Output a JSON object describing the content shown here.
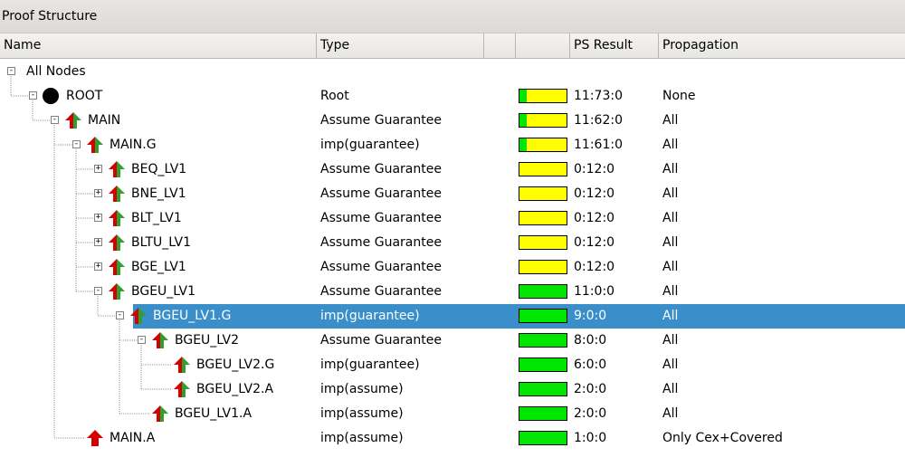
{
  "panel": {
    "title": "Proof Structure"
  },
  "columns": [
    {
      "label": "Name"
    },
    {
      "label": "Type"
    },
    {
      "label": ""
    },
    {
      "label": ""
    },
    {
      "label": "PS Result"
    },
    {
      "label": "Propagation"
    }
  ],
  "colors": {
    "pass": "#00e600",
    "pending": "#ffff00",
    "selection": "#3a8fcb",
    "arrow_red": "#d40000",
    "arrow_green": "#2ea02e"
  },
  "tree": {
    "all_nodes": "All Nodes",
    "rows": [
      {
        "name": "ROOT",
        "type": "Root",
        "result": "11:73:0",
        "propagation": "None",
        "icon": "root-node-icon",
        "pass_fraction": 0.15,
        "expander": "-"
      },
      {
        "name": "MAIN",
        "type": "Assume Guarantee",
        "result": "11:62:0",
        "propagation": "All",
        "icon": "assume-guarantee-icon",
        "pass_fraction": 0.15,
        "expander": "-"
      },
      {
        "name": "MAIN.G",
        "type": "imp(guarantee)",
        "result": "11:61:0",
        "propagation": "All",
        "icon": "assume-guarantee-icon",
        "pass_fraction": 0.15,
        "expander": "-"
      },
      {
        "name": "BEQ_LV1",
        "type": "Assume Guarantee",
        "result": "0:12:0",
        "propagation": "All",
        "icon": "assume-guarantee-icon",
        "pass_fraction": 0,
        "expander": "+"
      },
      {
        "name": "BNE_LV1",
        "type": "Assume Guarantee",
        "result": "0:12:0",
        "propagation": "All",
        "icon": "assume-guarantee-icon",
        "pass_fraction": 0,
        "expander": "+"
      },
      {
        "name": "BLT_LV1",
        "type": "Assume Guarantee",
        "result": "0:12:0",
        "propagation": "All",
        "icon": "assume-guarantee-icon",
        "pass_fraction": 0,
        "expander": "+"
      },
      {
        "name": "BLTU_LV1",
        "type": "Assume Guarantee",
        "result": "0:12:0",
        "propagation": "All",
        "icon": "assume-guarantee-icon",
        "pass_fraction": 0,
        "expander": "+"
      },
      {
        "name": "BGE_LV1",
        "type": "Assume Guarantee",
        "result": "0:12:0",
        "propagation": "All",
        "icon": "assume-guarantee-icon",
        "pass_fraction": 0,
        "expander": "+"
      },
      {
        "name": "BGEU_LV1",
        "type": "Assume Guarantee",
        "result": "11:0:0",
        "propagation": "All",
        "icon": "assume-guarantee-icon",
        "pass_fraction": 1,
        "expander": "-"
      },
      {
        "name": "BGEU_LV1.G",
        "type": "imp(guarantee)",
        "result": "9:0:0",
        "propagation": "All",
        "icon": "assume-guarantee-icon",
        "pass_fraction": 1,
        "expander": "-",
        "selected": true
      },
      {
        "name": "BGEU_LV2",
        "type": "Assume Guarantee",
        "result": "8:0:0",
        "propagation": "All",
        "icon": "assume-guarantee-icon",
        "pass_fraction": 1,
        "expander": "-"
      },
      {
        "name": "BGEU_LV2.G",
        "type": "imp(guarantee)",
        "result": "6:0:0",
        "propagation": "All",
        "icon": "assume-guarantee-icon",
        "pass_fraction": 1
      },
      {
        "name": "BGEU_LV2.A",
        "type": "imp(assume)",
        "result": "2:0:0",
        "propagation": "All",
        "icon": "assume-guarantee-icon",
        "pass_fraction": 1
      },
      {
        "name": "BGEU_LV1.A",
        "type": "imp(assume)",
        "result": "2:0:0",
        "propagation": "All",
        "icon": "assume-guarantee-icon",
        "pass_fraction": 1
      },
      {
        "name": "MAIN.A",
        "type": "imp(assume)",
        "result": "1:0:0",
        "propagation": "Only Cex+Covered",
        "icon": "assume-red-arrow-icon",
        "pass_fraction": 1
      }
    ]
  }
}
